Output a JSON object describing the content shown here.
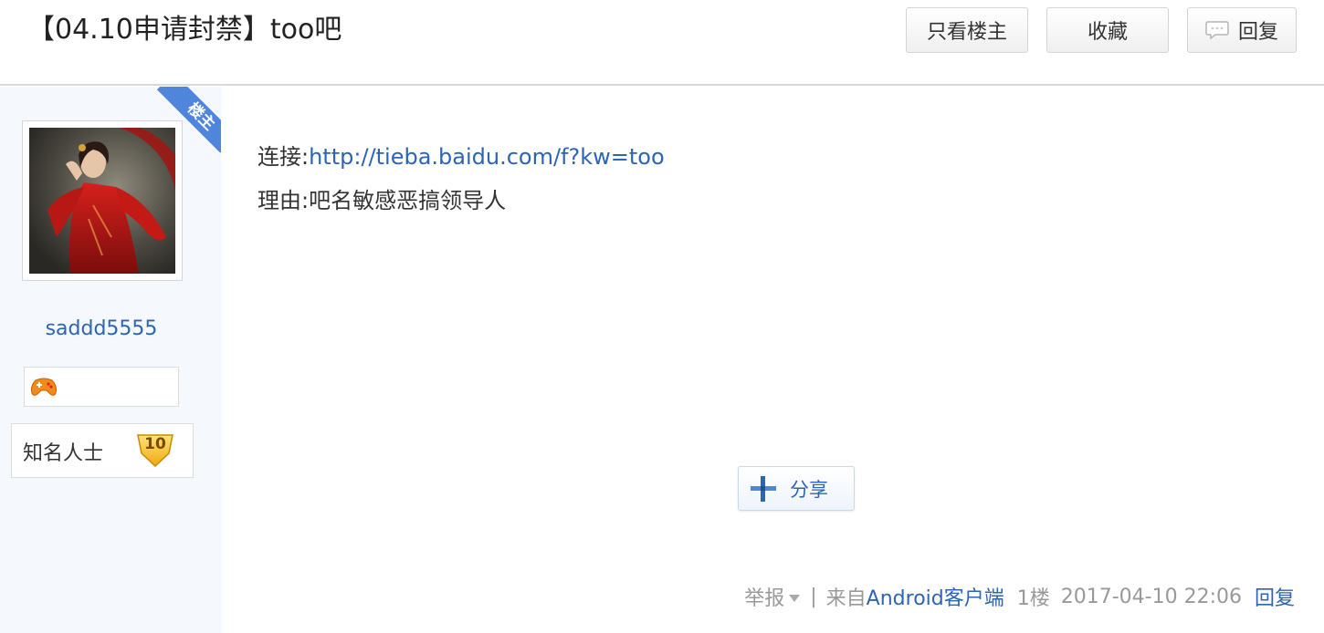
{
  "thread": {
    "title": "【04.10申请封禁】too吧",
    "buttons": {
      "only_lz": "只看楼主",
      "favorite": "收藏",
      "reply": "回复"
    }
  },
  "author": {
    "lz_tag": "楼主",
    "username": "saddd5555",
    "level_name": "知名人士",
    "level": "10"
  },
  "post": {
    "link_prefix": "连接:",
    "link_url": "http://tieba.baidu.com/f?kw=too",
    "reason": "理由:吧名敏感恶搞领导人",
    "share_label": "分享"
  },
  "footer": {
    "report": "举报",
    "separator": "|",
    "from_prefix": "来自",
    "client": "Android客户端",
    "floor": "1楼",
    "timestamp": "2017-04-10 22:06",
    "reply": "回复"
  },
  "colors": {
    "link": "#2d64b3",
    "ribbon": "#4f86dc",
    "sidebar_bg": "#f5f8fc"
  },
  "icons": {
    "reply_button": "speech-bubble-icon",
    "share": "plus-cross-icon",
    "badge": "game-controller-icon",
    "level": "shield-badge-icon",
    "report_dropdown": "caret-down-icon"
  }
}
